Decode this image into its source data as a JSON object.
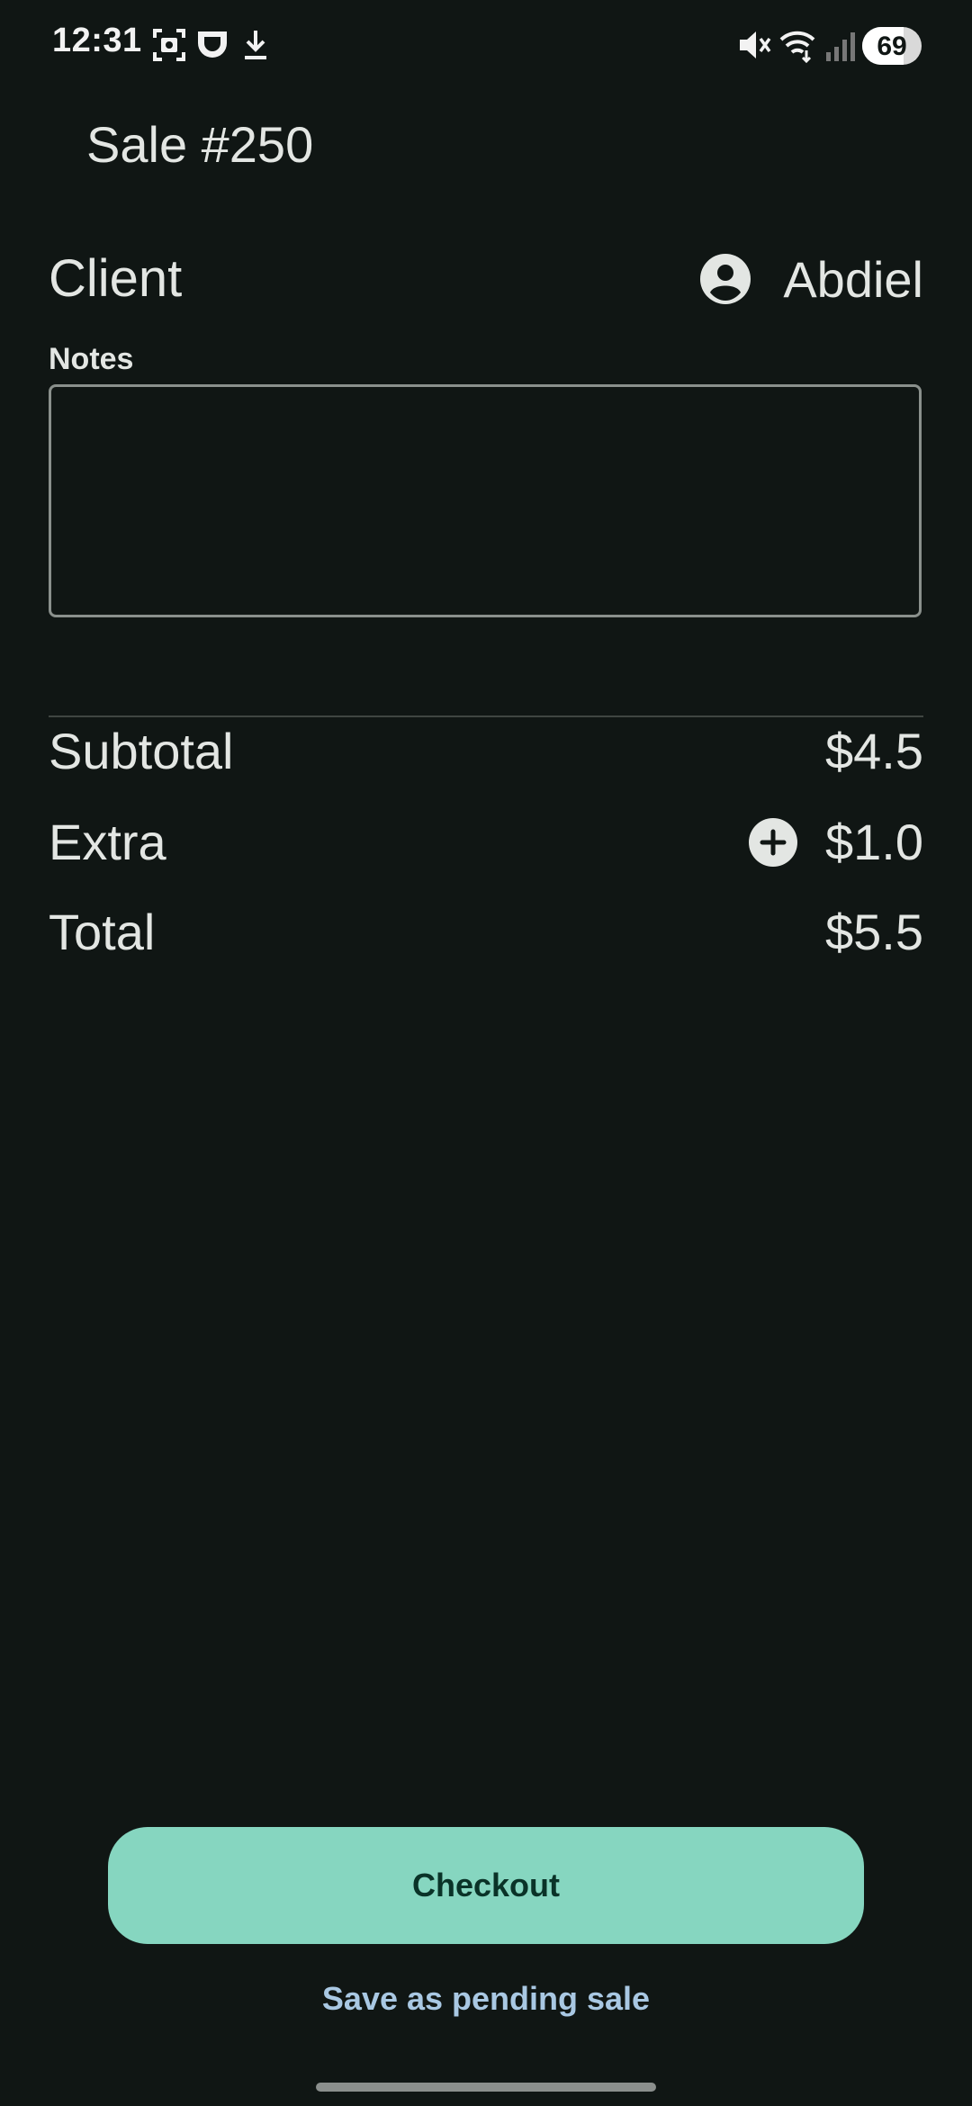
{
  "status_bar": {
    "time": "12:31",
    "battery_level": "69",
    "battery_fraction": 0.69,
    "icons": [
      "screenshot-icon",
      "app-icon",
      "download-icon",
      "mute-icon",
      "wifi-icon",
      "signal-icon"
    ]
  },
  "header": {
    "title": "Sale #250"
  },
  "client": {
    "label": "Client",
    "name": "Abdiel",
    "icon": "account-circle-icon"
  },
  "notes": {
    "label": "Notes",
    "value": "",
    "placeholder": ""
  },
  "totals": {
    "subtotal_label": "Subtotal",
    "subtotal_value": "$4.5",
    "extra_label": "Extra",
    "extra_value": "$1.0",
    "extra_icon": "add-circle-icon",
    "total_label": "Total",
    "total_value": "$5.5"
  },
  "actions": {
    "checkout_label": "Checkout",
    "pending_label": "Save as pending sale"
  },
  "colors": {
    "background": "#101614",
    "accent": "#86d6c0",
    "link": "#a9c8e3",
    "text": "#e3e6e3"
  }
}
